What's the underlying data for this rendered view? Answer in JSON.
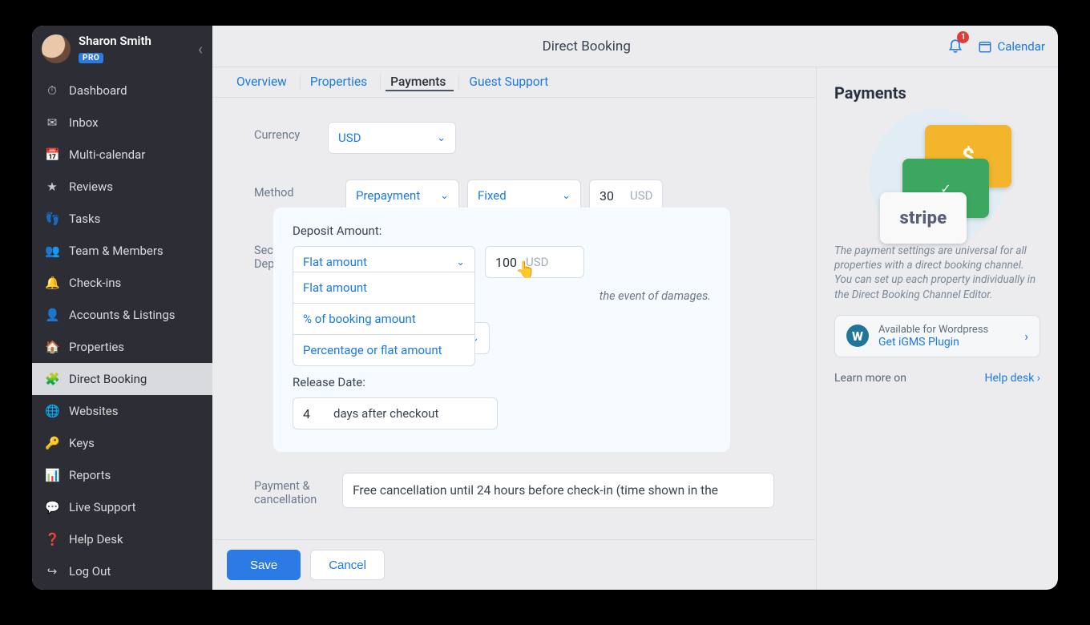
{
  "user": {
    "name": "Sharon Smith",
    "badge": "PRO"
  },
  "sidebar": [
    {
      "icon": "⏱",
      "label": "Dashboard"
    },
    {
      "icon": "✉",
      "label": "Inbox"
    },
    {
      "icon": "📅",
      "label": "Multi-calendar"
    },
    {
      "icon": "★",
      "label": "Reviews"
    },
    {
      "icon": "👣",
      "label": "Tasks"
    },
    {
      "icon": "👥",
      "label": "Team & Members"
    },
    {
      "icon": "🔔",
      "label": "Check-ins"
    },
    {
      "icon": "👤",
      "label": "Accounts & Listings"
    },
    {
      "icon": "🏠",
      "label": "Properties"
    },
    {
      "icon": "🧩",
      "label": "Direct Booking",
      "active": true
    },
    {
      "icon": "🌐",
      "label": "Websites"
    },
    {
      "icon": "🔑",
      "label": "Keys"
    },
    {
      "icon": "📊",
      "label": "Reports"
    },
    {
      "icon": "💬",
      "label": "Live Support"
    },
    {
      "icon": "❓",
      "label": "Help Desk"
    },
    {
      "icon": "↪",
      "label": "Log Out"
    }
  ],
  "page": {
    "title": "Direct Booking",
    "calendar_label": "Calendar",
    "bell_count": "1"
  },
  "tabs": [
    "Overview",
    "Properties",
    "Payments",
    "Guest Support"
  ],
  "active_tab": "Payments",
  "form": {
    "currency_label": "Currency",
    "currency_value": "USD",
    "method_label": "Method",
    "method_value": "Prepayment",
    "method_value2": "Fixed",
    "method_amount": "30",
    "method_unit": "USD",
    "deposit_label": "Security Deposit",
    "policy_label": "Payment & cancellation",
    "policy_text": "Free cancellation until 24 hours before check-in (time shown in the"
  },
  "deposit_card": {
    "amount_label": "Deposit Amount:",
    "type_selected": "Flat amount",
    "amount_value": "100",
    "amount_unit": "USD",
    "hint": "the event of damages.",
    "options": [
      "Flat amount",
      "% of booking amount",
      "Percentage or flat amount"
    ],
    "release_label": "Release Date:",
    "release_value": "4",
    "release_unit": "days after checkout"
  },
  "footer": {
    "save": "Save",
    "cancel": "Cancel"
  },
  "rpanel": {
    "title": "Payments",
    "stripe": "stripe",
    "dollar": "$",
    "check": "✓",
    "desc": "The payment settings are universal for all properties with a direct booking channel. You can set up each property individually in the Direct Booking Channel Editor.",
    "wp": "W",
    "wp_t1": "Available for Wordpress",
    "wp_t2": "Get iGMS Plugin",
    "learn": "Learn more on",
    "help": "Help desk"
  }
}
